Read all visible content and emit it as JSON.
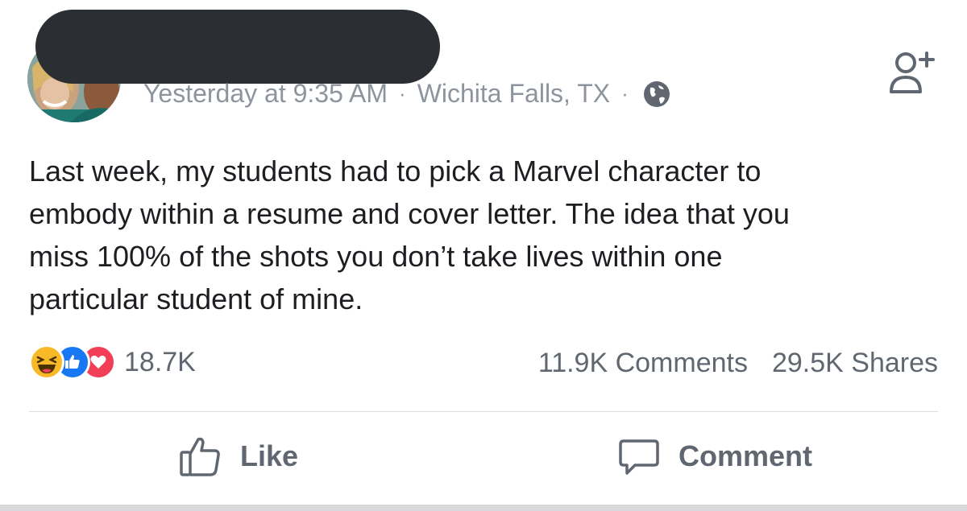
{
  "post": {
    "timestamp": "Yesterday at 9:35 AM",
    "separator": "·",
    "location": "Wichita Falls, TX",
    "privacy_icon": "globe-icon",
    "body_lines": [
      "Last week, my students had to pick a Marvel character to",
      "embody within a resume and cover letter. The idea that you",
      "miss 100% of the shots you don’t take lives within one",
      "particular student of mine."
    ]
  },
  "reactions": {
    "icons": [
      "haha-icon",
      "like-icon",
      "love-icon"
    ],
    "count": "18.7K"
  },
  "stats": {
    "comments": "11.9K Comments",
    "shares": "29.5K Shares"
  },
  "actions": {
    "like_label": "Like",
    "comment_label": "Comment"
  },
  "colors": {
    "meta_text": "#8d949e",
    "body_text": "#1c1e21",
    "action_text": "#606770",
    "like_blue": "#1877f2",
    "love_red": "#f33e58",
    "haha_yellow": "#f7b928",
    "redaction": "#2b2e33"
  }
}
